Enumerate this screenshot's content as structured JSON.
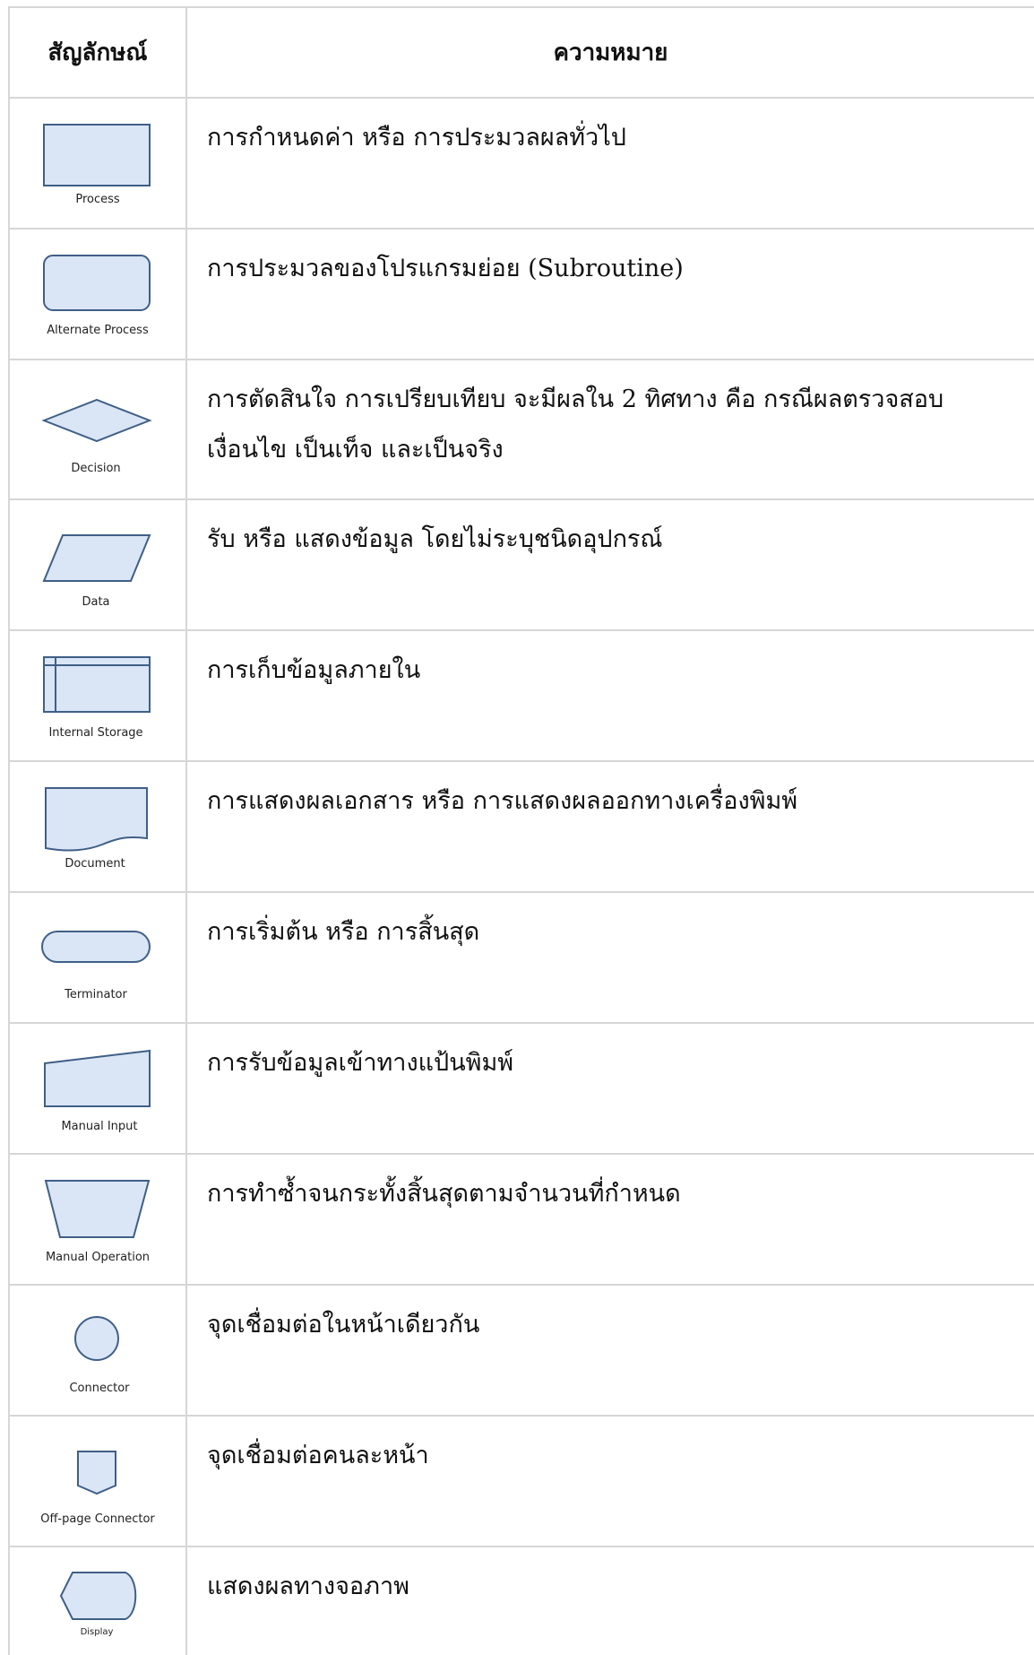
{
  "header": {
    "symbol": "สัญลักษณ์",
    "meaning": "ความหมาย"
  },
  "rows": [
    {
      "label": "Process",
      "icon": "process-rectangle-icon",
      "meaning": "การกำหนดค่า หรือ การประมวลผลทั่วไป"
    },
    {
      "label": "Alternate Process",
      "icon": "rounded-rectangle-icon",
      "meaning": "การประมวลของโปรแกรมย่อย (Subroutine)"
    },
    {
      "label": "Decision",
      "icon": "diamond-icon",
      "meaning": "การตัดสินใจ การเปรียบเทียบ จะมีผลใน 2 ทิศทาง คือ กรณีผลตรวจสอบเงื่อนไข เป็นเท็จ และเป็นจริง"
    },
    {
      "label": "Data",
      "icon": "parallelogram-icon",
      "meaning": "รับ หรือ แสดงข้อมูล โดยไม่ระบุชนิดอุปกรณ์"
    },
    {
      "label": "Internal Storage",
      "icon": "internal-storage-icon",
      "meaning": "การเก็บข้อมูลภายใน"
    },
    {
      "label": "Document",
      "icon": "document-icon",
      "meaning": "การแสดงผลเอกสาร หรือ การแสดงผลออกทางเครื่องพิมพ์"
    },
    {
      "label": "Terminator",
      "icon": "terminator-icon",
      "meaning": "การเริ่มต้น หรือ การสิ้นสุด"
    },
    {
      "label": "Manual Input",
      "icon": "manual-input-icon",
      "meaning": "การรับข้อมูลเข้าทางแป้นพิมพ์"
    },
    {
      "label": "Manual Operation",
      "icon": "trapezoid-icon",
      "meaning": "การทำซ้ำจนกระทั้งสิ้นสุดตามจำนวนที่กำหนด"
    },
    {
      "label": "Connector",
      "icon": "circle-icon",
      "meaning": "จุดเชื่อมต่อในหน้าเดียวกัน"
    },
    {
      "label": "Off-page Connector",
      "icon": "off-page-connector-icon",
      "meaning": "จุดเชื่อมต่อคนละหน้า"
    },
    {
      "label": "Display",
      "icon": "display-icon",
      "meaning": "แสดงผลทางจอภาพ"
    }
  ]
}
